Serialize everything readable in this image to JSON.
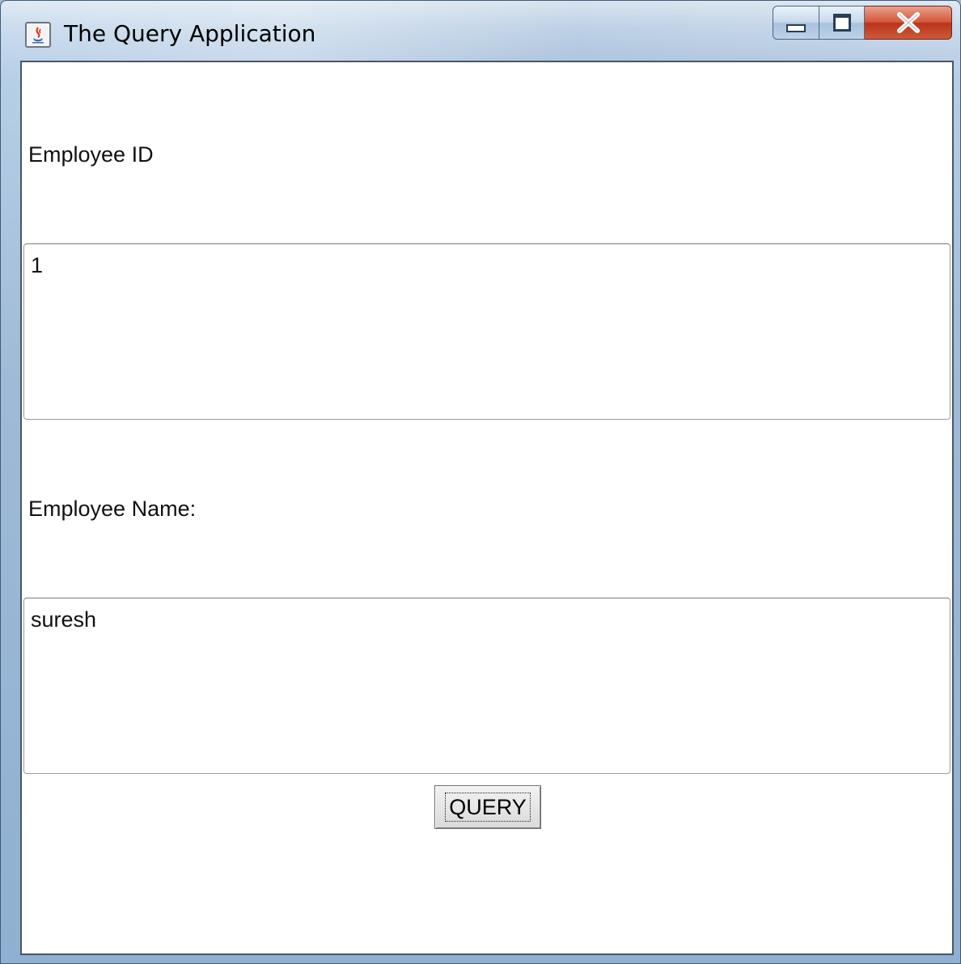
{
  "window": {
    "title": "The Query Application",
    "icon": "java-icon"
  },
  "controls": {
    "minimize": "minimize-icon",
    "maximize": "maximize-icon",
    "close": "close-icon"
  },
  "form": {
    "employee_id_label": "Employee ID",
    "employee_id_value": "1",
    "employee_name_label": "Employee Name:",
    "employee_name_value": "suresh",
    "query_button": "QUERY"
  }
}
